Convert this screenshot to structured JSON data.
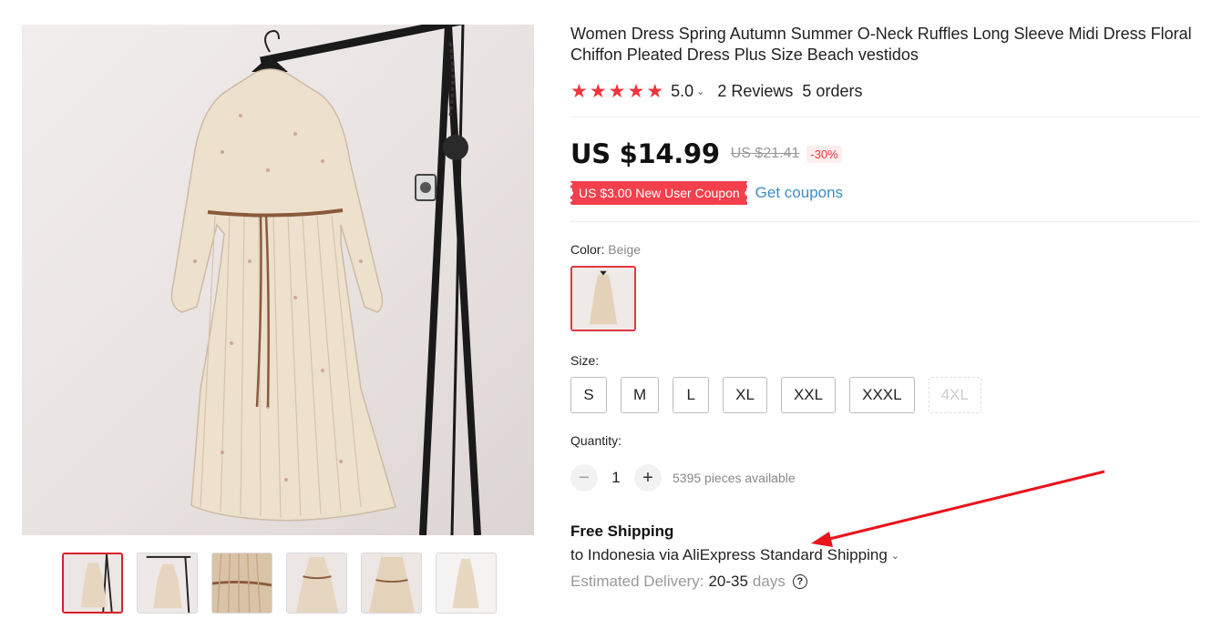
{
  "product": {
    "title": "Women Dress Spring Autumn Summer O-Neck Ruffles Long Sleeve Midi Dress Floral Chiffon Pleated Dress Plus Size Beach vestidos",
    "rating": "5.0",
    "stars": 5,
    "reviews": "2 Reviews",
    "orders": "5 orders"
  },
  "price": {
    "current": "US $14.99",
    "original": "US $21.41",
    "discount": "-30%"
  },
  "coupon": {
    "label": "US $3.00 New User Coupon",
    "link": "Get coupons"
  },
  "color": {
    "label": "Color:",
    "selected": "Beige"
  },
  "size": {
    "label": "Size:",
    "options": [
      "S",
      "M",
      "L",
      "XL",
      "XXL",
      "XXXL",
      "4XL"
    ],
    "disabled": [
      "4XL"
    ]
  },
  "quantity": {
    "label": "Quantity:",
    "value": "1",
    "available": "5395 pieces available"
  },
  "shipping": {
    "title": "Free Shipping",
    "route": "to Indonesia via AliExpress Standard Shipping",
    "delivery_label": "Estimated Delivery:",
    "delivery_range": "20-35",
    "delivery_unit": "days"
  },
  "gallery": {
    "thumbnail_count": 6,
    "active_index": 0
  },
  "colors": {
    "accent_red": "#f1333f",
    "link_blue": "#3d8dc4",
    "annotation_arrow": "#e8141c"
  },
  "icons": [
    "star-icon",
    "chevron-down-icon",
    "minus-icon",
    "plus-icon",
    "help-icon"
  ]
}
